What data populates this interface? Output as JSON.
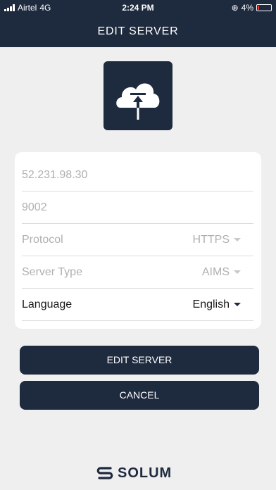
{
  "status": {
    "carrier": "Airtel",
    "network": "4G",
    "time": "2:24 PM",
    "battery": "4%"
  },
  "header": {
    "title": "EDIT SERVER"
  },
  "form": {
    "ip_placeholder": "52.231.98.30",
    "port_placeholder": "9002",
    "protocol_label": "Protocol",
    "protocol_value": "HTTPS",
    "server_type_label": "Server Type",
    "server_type_value": "AIMS",
    "language_label": "Language",
    "language_value": "English"
  },
  "buttons": {
    "edit": "EDIT SERVER",
    "cancel": "CANCEL"
  },
  "brand": {
    "name": "SOLUM"
  },
  "colors": {
    "primary": "#1e2a3e",
    "background": "#efeff0"
  }
}
